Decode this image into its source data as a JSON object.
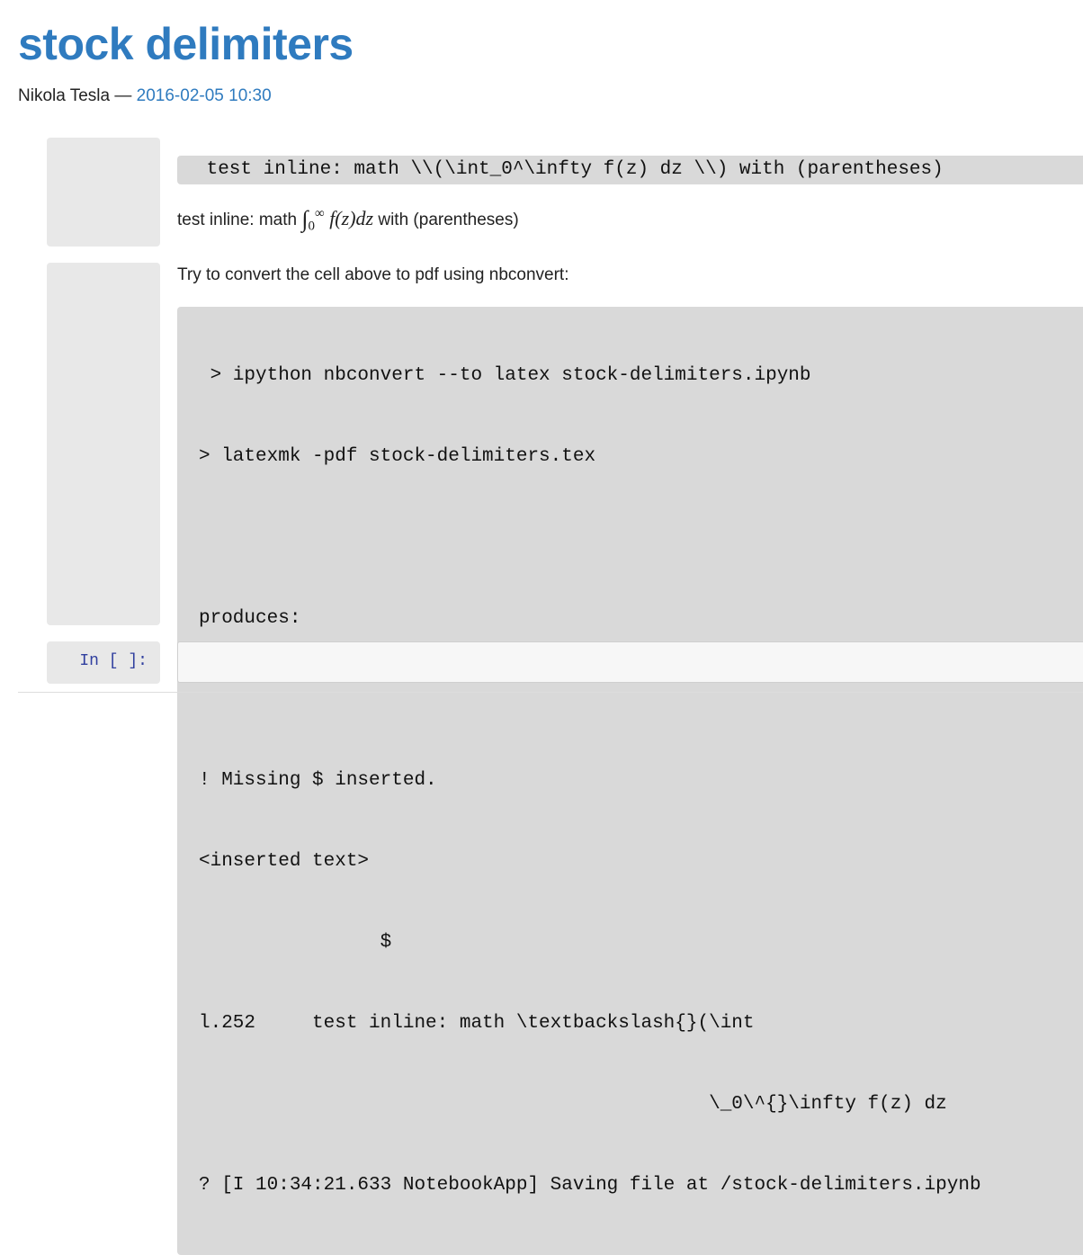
{
  "page": {
    "title": "stock delimiters",
    "author": "Nikola Tesla",
    "separator": "—",
    "date": "2016-02-05 10:30"
  },
  "cell1": {
    "code": " test inline: math \\\\(\\int_0^\\infty f(z) dz \\\\) with (parentheses)",
    "rendered_prefix": "test inline: math",
    "math_lower": "0",
    "math_upper": "∞",
    "math_body": "f(z)dz",
    "rendered_suffix": "with (parentheses)"
  },
  "cell2": {
    "intro": "Try to convert the cell above to pdf using nbconvert:",
    "lines": [
      " > ipython nbconvert --to latex stock-delimiters.ipynb",
      "> latexmk -pdf stock-delimiters.tex",
      "",
      "produces:",
      "",
      "! Missing $ inserted.",
      "<inserted text>",
      "                $",
      "l.252     test inline: math \\textbackslash{}(\\int",
      "                                             \\_0\\^{}\\infty f(z) dz",
      "? [I 10:34:21.633 NotebookApp] Saving file at /stock-delimiters.ipynb"
    ]
  },
  "cell3": {
    "prompt": "In [ ]:",
    "input_value": ""
  }
}
